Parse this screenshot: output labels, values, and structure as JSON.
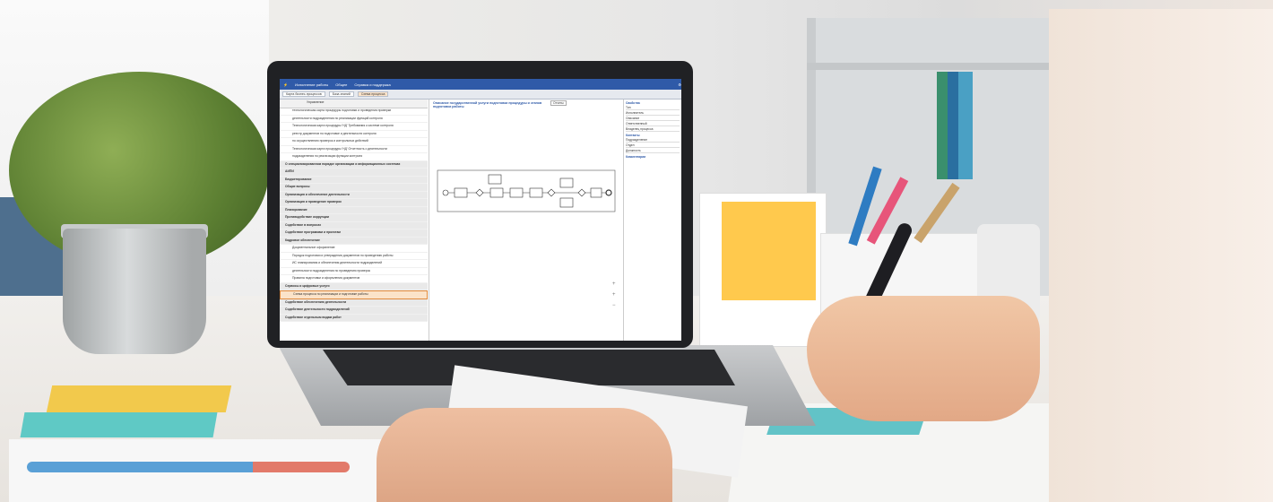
{
  "screen": {
    "app_menu": [
      "Исполнение работы",
      "Общее",
      "Справка и поддержка"
    ],
    "tabs": [
      "Карта бизнес-процессов",
      "База знаний",
      "Схема процесса"
    ],
    "tree_search_label": "Управление",
    "tree_rows": [
      {
        "label": "технологическая карта процедуры подготовки и проведения проверки",
        "kind": "item"
      },
      {
        "label": "деятельности подразделения по реализации функций контроля",
        "kind": "item"
      },
      {
        "label": "Технологическая карта процедуры 'НД' Требования к системе контроля",
        "kind": "item"
      },
      {
        "label": "реестр документов по подготовке и деятельности контроля",
        "kind": "item"
      },
      {
        "label": "по осуществлению проверок и контрольных действий",
        "kind": "item"
      },
      {
        "label": "Технологическая карта процедуры 'НД' Отчетность о деятельности",
        "kind": "item"
      },
      {
        "label": "подразделения по реализации функции контроля",
        "kind": "item"
      },
      {
        "label": "О специализированном порядке организации и информационных системах",
        "kind": "group"
      },
      {
        "label": "АИПИ",
        "kind": "group"
      },
      {
        "label": "Бюджетирование",
        "kind": "group"
      },
      {
        "label": "Общие вопросы",
        "kind": "group"
      },
      {
        "label": "Организация и обеспечение деятельности",
        "kind": "group"
      },
      {
        "label": "Организация и проведение проверок",
        "kind": "group"
      },
      {
        "label": "Планирование",
        "kind": "group"
      },
      {
        "label": "Противодействие коррупции",
        "kind": "group"
      },
      {
        "label": "Содействие в вопросах",
        "kind": "group"
      },
      {
        "label": "Содействие программам и проектам",
        "kind": "group"
      },
      {
        "label": "Кадровое обеспечение",
        "kind": "group"
      },
      {
        "label": "Документальное оформление",
        "kind": "item"
      },
      {
        "label": "Порядок подготовки и утверждения документов по проведению работы",
        "kind": "item"
      },
      {
        "label": "ИС планирования и обеспечения деятельности подразделений",
        "kind": "item"
      },
      {
        "label": "деятельности подразделения по проведению проверок",
        "kind": "item"
      },
      {
        "label": "Правила подготовки и оформления документов",
        "kind": "item"
      },
      {
        "label": "Сервисы и цифровые услуги",
        "kind": "group"
      },
      {
        "label": "Схема процесса по реализации и подготовке работы",
        "kind": "selected"
      },
      {
        "label": "Содействие обеспечению деятельности",
        "kind": "group"
      },
      {
        "label": "Содействие деятельности подразделений",
        "kind": "group"
      },
      {
        "label": "Содействие отдельным видам работ",
        "kind": "group"
      }
    ],
    "center_title": "Описание государственной услуги подготовки процедуры и этапов подготовки работы",
    "center_toolbar": [
      "Отчеты"
    ],
    "diagram_tools": [
      "+",
      "+",
      "−"
    ],
    "right_panel": {
      "section1": "Свойства",
      "section1_rows": [
        "Тип",
        "Исполнитель",
        "Описание",
        "Ответственный",
        "Владелец процесса"
      ],
      "section2": "Контакты",
      "section2_rows": [
        "Подразделение",
        "Отдел",
        "Должность"
      ],
      "section3": "Комментарии"
    }
  },
  "colors": {
    "brand": "#2f5aa8",
    "selected_bg": "#fbe3c9",
    "selected_border": "#e08a3c"
  }
}
